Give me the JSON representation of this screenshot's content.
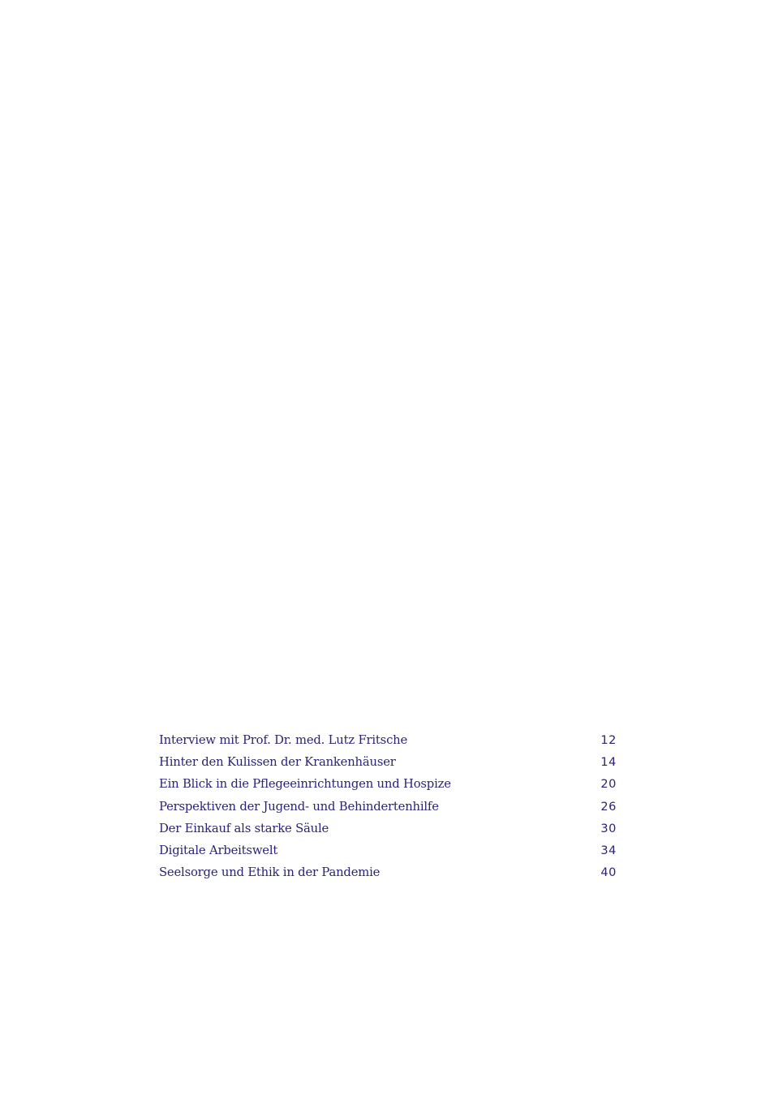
{
  "colors": {
    "text": "#2a2378",
    "background": "#ffffff"
  },
  "toc": {
    "entries": [
      {
        "title": "Interview mit Prof. Dr. med. Lutz Fritsche",
        "page": "12"
      },
      {
        "title": "Hinter den Kulissen der Krankenhäuser",
        "page": "14"
      },
      {
        "title": "Ein Blick in die Pflegeeinrichtungen und Hospize",
        "page": "20"
      },
      {
        "title": "Perspektiven der Jugend- und Behindertenhilfe",
        "page": "26"
      },
      {
        "title": "Der Einkauf als starke Säule",
        "page": "30"
      },
      {
        "title": "Digitale Arbeitswelt",
        "page": "34"
      },
      {
        "title": "Seelsorge und Ethik in der Pandemie",
        "page": "40"
      }
    ]
  }
}
